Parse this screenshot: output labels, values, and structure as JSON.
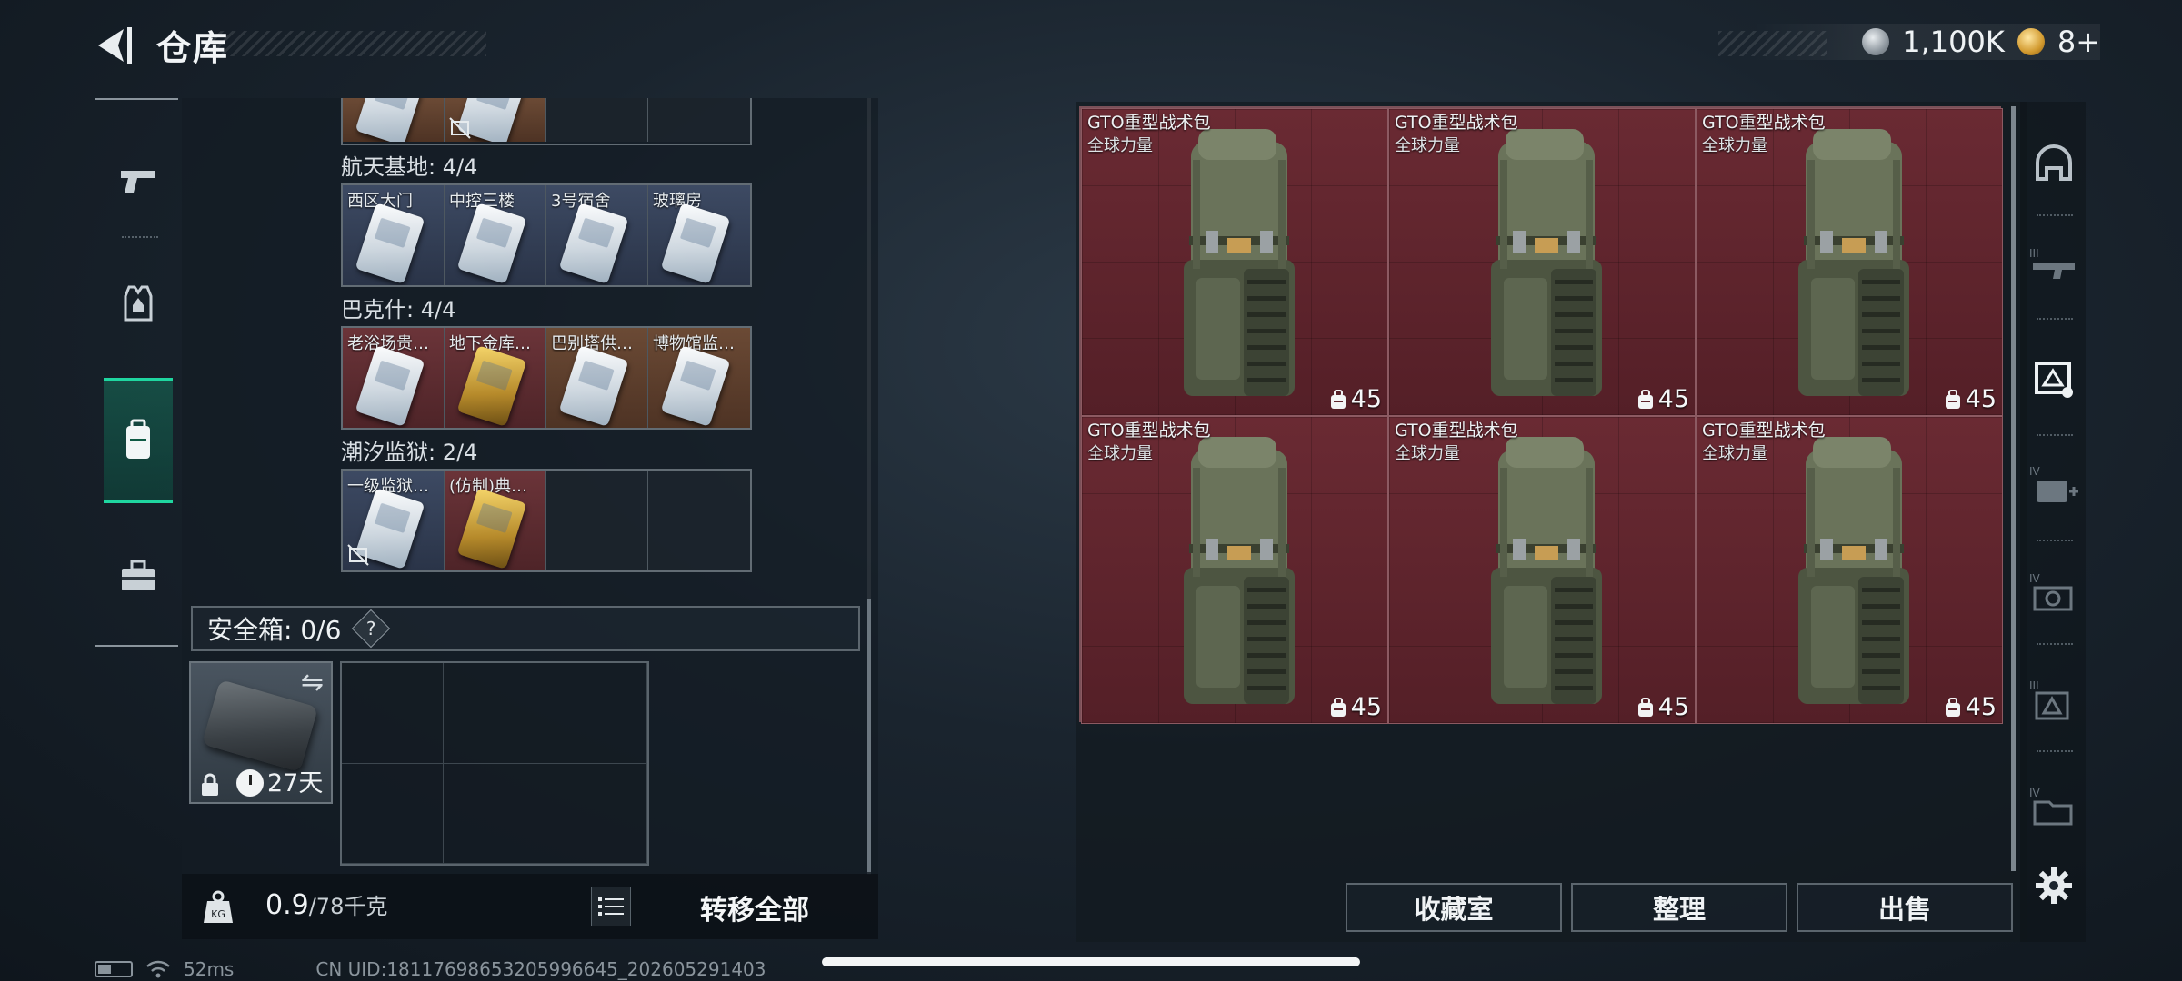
{
  "header": {
    "title": "仓库",
    "currency": [
      {
        "icon": "silver-coin-icon",
        "value": "1,100K"
      },
      {
        "icon": "gold-coin-icon",
        "value": "8+"
      }
    ]
  },
  "left_rail": {
    "items": [
      {
        "name": "weapons",
        "icon": "pistol-icon",
        "active": false
      },
      {
        "name": "armor",
        "icon": "vest-icon",
        "active": false
      },
      {
        "name": "containers",
        "icon": "backpack-icon",
        "active": true
      },
      {
        "name": "tools",
        "icon": "briefcase-icon",
        "active": false
      }
    ]
  },
  "keycard_groups": [
    {
      "title": "航天基地: 4/4",
      "cells": [
        {
          "label": "西区大门",
          "color": "blue",
          "card": "white"
        },
        {
          "label": "中控三楼",
          "color": "blue",
          "card": "white"
        },
        {
          "label": "3号宿舍",
          "color": "blue",
          "card": "white"
        },
        {
          "label": "玻璃房",
          "color": "blue",
          "card": "white"
        }
      ]
    },
    {
      "title": "巴克什: 4/4",
      "cells": [
        {
          "label": "老浴场贵…",
          "color": "red",
          "card": "white"
        },
        {
          "label": "地下金库…",
          "color": "red",
          "card": "gold"
        },
        {
          "label": "巴别塔供…",
          "color": "orange",
          "card": "white"
        },
        {
          "label": "博物馆监…",
          "color": "orange",
          "card": "white"
        }
      ]
    },
    {
      "title": "潮汐监狱: 2/4",
      "cells": [
        {
          "label": "一级监狱…",
          "color": "blue",
          "card": "white",
          "nodrop": true
        },
        {
          "label": "(仿制)典…",
          "color": "red",
          "card": "gold"
        },
        {
          "label": "",
          "color": "empty"
        },
        {
          "label": "",
          "color": "empty"
        }
      ]
    }
  ],
  "safe_box": {
    "title": "安全箱: 0/6",
    "help": "?",
    "days_left": "27天"
  },
  "bottom_left": {
    "weight_current": "0.9",
    "weight_max": "/78千克",
    "transfer_all": "转移全部"
  },
  "warehouse": {
    "items": [
      {
        "name": "GTO重型战术包",
        "sub": "全球力量",
        "capacity": "45"
      },
      {
        "name": "GTO重型战术包",
        "sub": "全球力量",
        "capacity": "45"
      },
      {
        "name": "GTO重型战术包",
        "sub": "全球力量",
        "capacity": "45"
      },
      {
        "name": "GTO重型战术包",
        "sub": "全球力量",
        "capacity": "45"
      },
      {
        "name": "GTO重型战术包",
        "sub": "全球力量",
        "capacity": "45"
      },
      {
        "name": "GTO重型战术包",
        "sub": "全球力量",
        "capacity": "45"
      }
    ]
  },
  "right_rail": {
    "items": [
      {
        "icon": "helmet-icon",
        "tier": ""
      },
      {
        "icon": "rifle-tier-icon",
        "tier": "III"
      },
      {
        "icon": "container-filter-icon",
        "tier": "",
        "active": true
      },
      {
        "icon": "medkit-tier-icon",
        "tier": "IV"
      },
      {
        "icon": "ammo-tier-icon",
        "tier": "IV"
      },
      {
        "icon": "part-tier-icon",
        "tier": "III"
      },
      {
        "icon": "folder-tier-icon",
        "tier": "IV"
      },
      {
        "icon": "gear-icon",
        "tier": ""
      }
    ]
  },
  "actions": {
    "collection_room": "收藏室",
    "organize": "整理",
    "sell": "出售"
  },
  "status_bar": {
    "ping": "52ms",
    "uid": "CN UID:181176986532059966​45_202605291403"
  },
  "colors": {
    "accent": "#1fd6a0",
    "bag_bg": "#5e242c",
    "keycard_blue": "#3d4a63",
    "keycard_red": "#6b3439"
  }
}
